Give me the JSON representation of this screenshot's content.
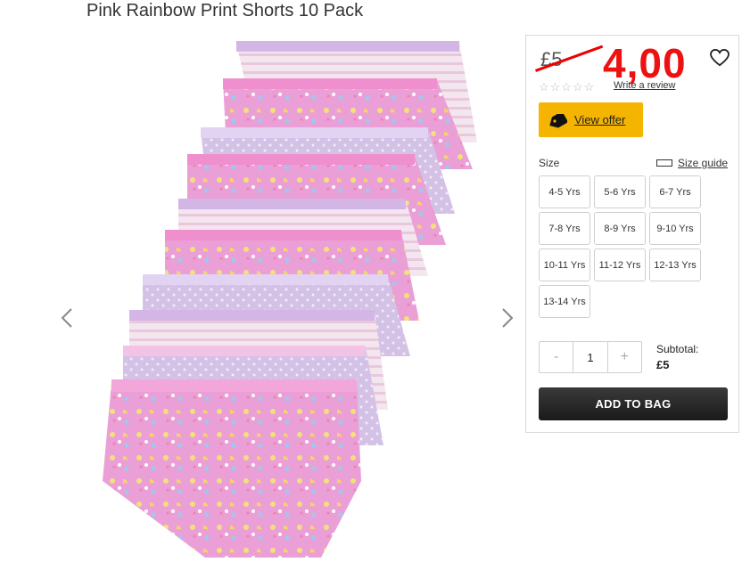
{
  "product": {
    "title": "Pink Rainbow Print Shorts 10 Pack",
    "image_alt": "Pack of pink, purple and white printed girls shorts"
  },
  "gallery": {
    "prev_icon": "chevron-left-icon",
    "next_icon": "chevron-right-icon"
  },
  "pricing": {
    "old_price": "£5",
    "new_price": "4,00",
    "price_color": "#ee1111"
  },
  "reviews": {
    "stars": "☆☆☆☆☆",
    "link_label": "Write a review"
  },
  "offer": {
    "label": "View offer",
    "color": "#f5b400"
  },
  "sizes": {
    "label": "Size",
    "guide_label": "Size guide",
    "options": [
      "4-5 Yrs",
      "5-6 Yrs",
      "6-7 Yrs",
      "7-8 Yrs",
      "8-9 Yrs",
      "9-10 Yrs",
      "10-11 Yrs",
      "11-12 Yrs",
      "12-13 Yrs",
      "13-14 Yrs"
    ]
  },
  "quantity": {
    "minus": "-",
    "value": "1",
    "plus": "+"
  },
  "subtotal": {
    "label": "Subtotal:",
    "value": "£5"
  },
  "cart": {
    "add_label": "ADD TO BAG"
  }
}
